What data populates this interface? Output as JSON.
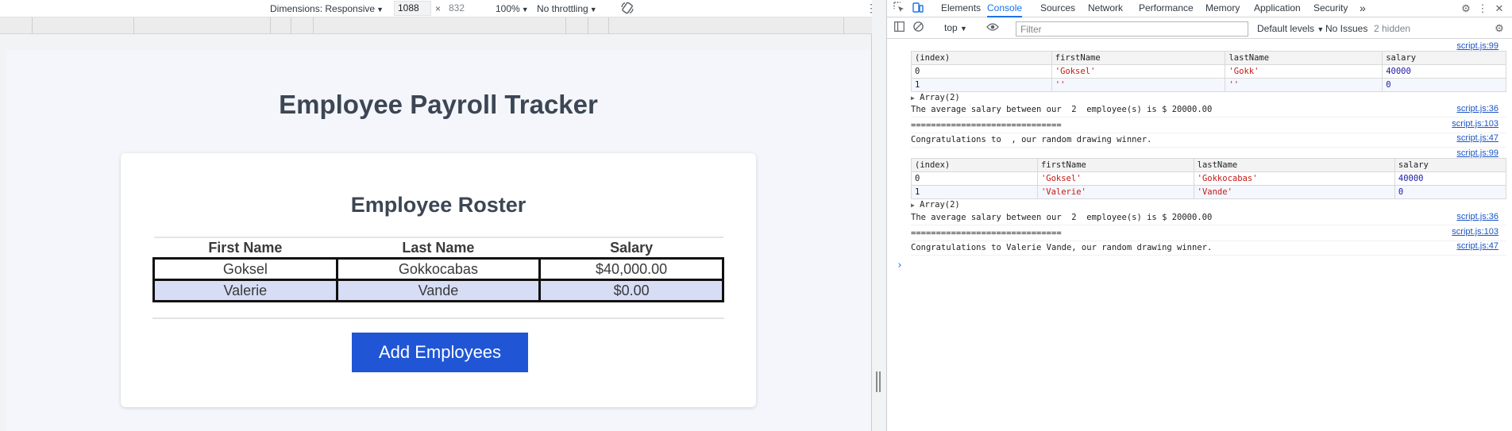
{
  "emulation_toolbar": {
    "dimensions_label": "Dimensions: Responsive",
    "width": "1088",
    "height": "832",
    "zoom": "100%",
    "throttling": "No throttling"
  },
  "page": {
    "title": "Employee Payroll Tracker",
    "roster_title": "Employee Roster",
    "columns": [
      "First Name",
      "Last Name",
      "Salary"
    ],
    "rows": [
      {
        "first": "Goksel",
        "last": "Gokkocabas",
        "salary": "$40,000.00"
      },
      {
        "first": "Valerie",
        "last": "Vande",
        "salary": "$0.00"
      }
    ],
    "add_button": "Add Employees"
  },
  "devtools": {
    "tabs": [
      "Elements",
      "Console",
      "Sources",
      "Network",
      "Performance",
      "Memory",
      "Application",
      "Security"
    ],
    "active_tab": "Console",
    "more_tabs": "»",
    "context": "top",
    "filter_placeholder": "Filter",
    "levels": "Default levels",
    "issues": "No Issues",
    "hidden": "2 hidden",
    "table_headers": [
      "(index)",
      "firstName",
      "lastName",
      "salary"
    ],
    "log": {
      "src1": "script.js:99",
      "table1": [
        {
          "index": "0",
          "firstName": "'Goksel'",
          "lastName": "'Gokk'",
          "salary": "40000"
        },
        {
          "index": "1",
          "firstName": "''",
          "lastName": "''",
          "salary": "0"
        }
      ],
      "array1": "Array(2)",
      "avg1": "The average salary between our  2  employee(s) is $ 20000.00",
      "avg1_src": "script.js:36",
      "sep1": "==============================",
      "sep1_src": "script.js:103",
      "winner1": "Congratulations to  , our random drawing winner.",
      "winner1_src": "script.js:47",
      "src2": "script.js:99",
      "table2": [
        {
          "index": "0",
          "firstName": "'Goksel'",
          "lastName": "'Gokkocabas'",
          "salary": "40000"
        },
        {
          "index": "1",
          "firstName": "'Valerie'",
          "lastName": "'Vande'",
          "salary": "0"
        }
      ],
      "array2": "Array(2)",
      "avg2": "The average salary between our  2  employee(s) is $ 20000.00",
      "avg2_src": "script.js:36",
      "sep2": "==============================",
      "sep2_src": "script.js:103",
      "winner2": "Congratulations to Valerie Vande, our random drawing winner.",
      "winner2_src": "script.js:47",
      "prompt": "›"
    }
  }
}
